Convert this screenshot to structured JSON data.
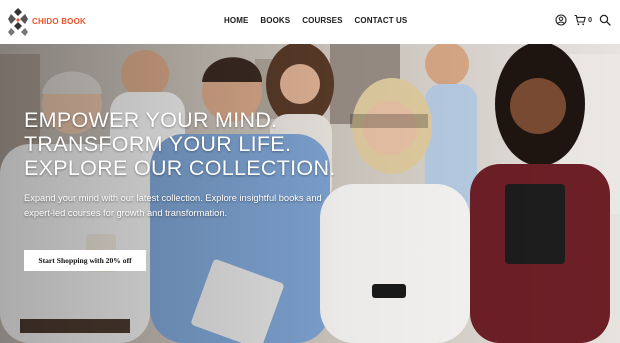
{
  "brand": {
    "name": "CHIDO BOOK",
    "accent": "#e8542a"
  },
  "nav": {
    "items": [
      {
        "label": "HOME"
      },
      {
        "label": "BOOKS"
      },
      {
        "label": "COURSES"
      },
      {
        "label": "CONTACT US"
      }
    ]
  },
  "header_icons": {
    "account": "user-icon",
    "cart": "cart-icon",
    "cart_count": "0",
    "search": "search-icon"
  },
  "hero": {
    "headline_line1": "EMPOWER YOUR MIND.",
    "headline_line2": "TRANSFORM YOUR LIFE.",
    "headline_line3": "EXPLORE OUR COLLECTION.",
    "subtext": "Expand your mind with our latest collection. Explore insightful books and expert-led courses for growth and transformation.",
    "cta_label": "Start Shopping with 20% off"
  }
}
